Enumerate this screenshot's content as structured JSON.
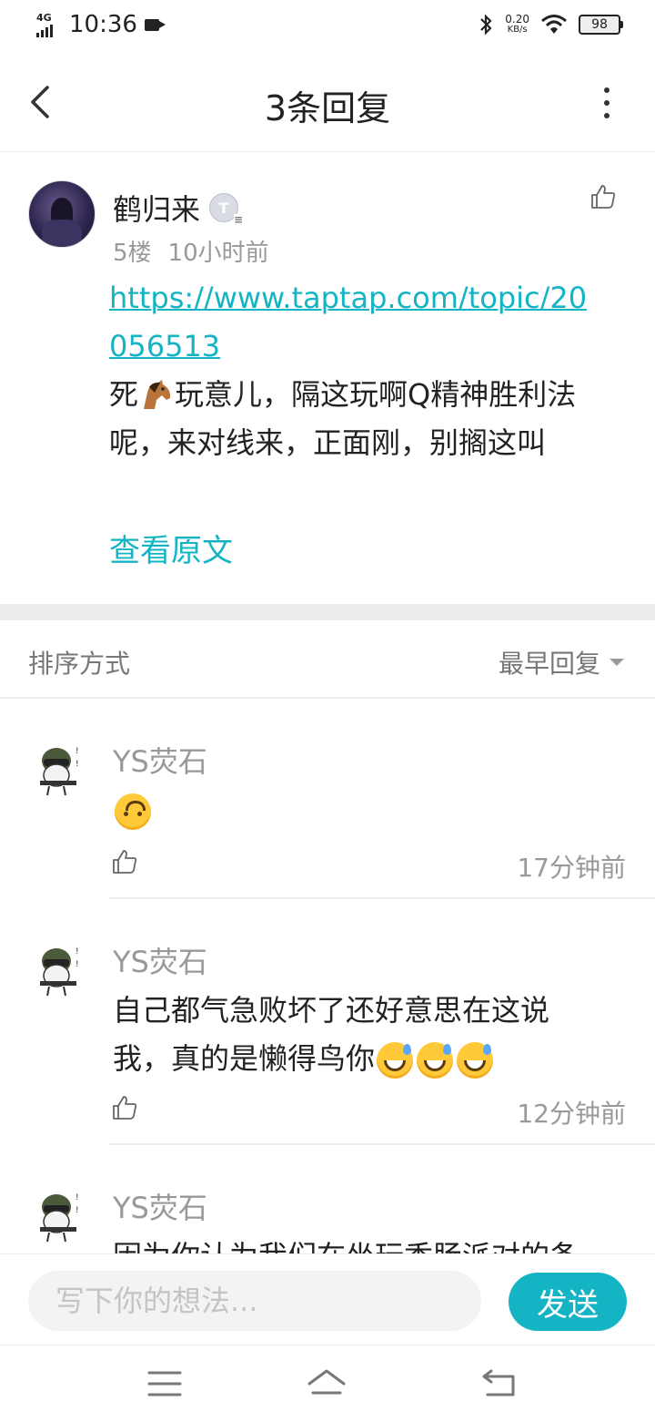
{
  "status_bar": {
    "network": "4G",
    "time": "10:36",
    "speed_value": "0.20",
    "speed_unit": "KB/s",
    "battery": "98"
  },
  "header": {
    "title": "3条回复"
  },
  "main_comment": {
    "author": "鹤归来",
    "badge": "T",
    "floor": "5楼",
    "time": "10小时前",
    "link": "https://www.taptap.com/topic/20056513",
    "text_before_emoji": "死",
    "text_after_emoji": "玩意儿，隔这玩啊Q精神胜利法呢，来对线来，正面刚，别搁这叫",
    "view_original": "查看原文"
  },
  "sort": {
    "label": "排序方式",
    "selected": "最早回复"
  },
  "replies": [
    {
      "name": "YS荧石",
      "text": "",
      "emoji": "upside-down-face",
      "time": "17分钟前"
    },
    {
      "name": "YS荧石",
      "text": "自己都气急败坏了还好意思在这说我，真的是懒得鸟你",
      "emoji": "grinning-sweat x3",
      "time": "12分钟前"
    },
    {
      "name": "YS荧石",
      "text": "因为你认为我们在坐玩香肠派对的条"
    }
  ],
  "input": {
    "placeholder": "写下你的想法...",
    "send_label": "发送"
  },
  "colors": {
    "accent": "#15b4c5",
    "muted_text": "#999999",
    "divider": "#ececec"
  }
}
